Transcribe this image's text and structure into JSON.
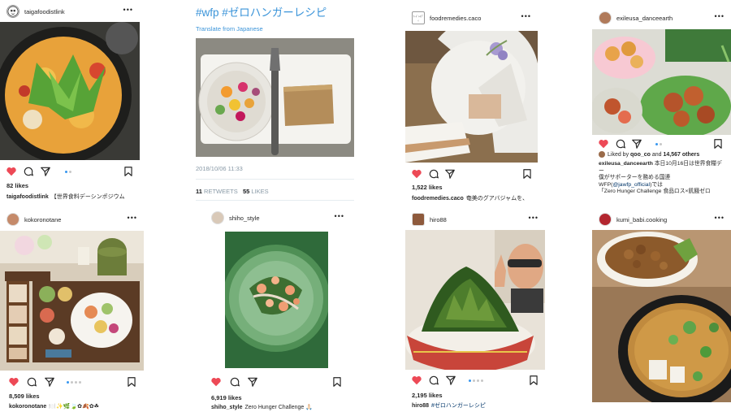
{
  "colors": {
    "heart": "#ed4956",
    "link": "#3b94d9",
    "dot_active": "#3897f0",
    "dot": "#c7c7c7"
  },
  "icons": [
    "heart-filled-icon",
    "comment-icon",
    "share-icon",
    "bookmark-icon",
    "more-icon"
  ],
  "posts": [
    {
      "username": "taigafoodistlink",
      "likes": "82 likes",
      "caption_user": "taigafoodistlink",
      "caption_text": "【世界食料デーシンポジウム"
    },
    {
      "username": "foodremedies.caco",
      "likes": "1,522 likes",
      "caption_user": "foodremedies.caco",
      "caption_text": "奄美のグアバジャムを、"
    },
    {
      "username": "exileusa_danceearth",
      "liked_by_pre": "Liked by ",
      "liked_by_user": "qoo_co",
      "liked_by_mid": " and ",
      "liked_by_count": "14,567 others",
      "caption_user": "exileusa_danceearth",
      "caption_line1": " 本日10月16日は世界食糧デー",
      "caption_line2": "僕がサポーターを務める国連",
      "caption_line3_pre": "WFP(",
      "caption_line3_mention": "@jawfp_official",
      "caption_line3_post": ")では",
      "caption_line4": "「Zero Hunger Challenge 食品ロス×飢餓ゼロ"
    },
    {
      "username": "kokoronotane",
      "likes": "8,509 likes",
      "caption_user": "kokoronotane",
      "caption_text": "🍽️✨🌿🍃✿🍂✿☘"
    },
    {
      "username": "shiho_style",
      "likes": "6,919 likes",
      "caption_user": "shiho_style",
      "caption_text": "Zero Hunger Challenge 🙏🏻"
    },
    {
      "username": "hiro88",
      "likes": "2,195 likes",
      "caption_user": "hiro88",
      "caption_tag": "#ゼロハンガーレシピ"
    },
    {
      "username": "kumi_babi.cooking"
    }
  ],
  "tweet": {
    "title": "#wfp #ゼロハンガーレシピ",
    "translate": "Translate from Japanese",
    "date": "2018/10/06 11:33",
    "retweets_count": "11",
    "retweets_label": "RETWEETS",
    "likes_count": "55",
    "likes_label": "LIKES"
  },
  "avatar_texts": {
    "foodremedies": "ﾌｰﾄﾞ ﾚﾒﾃﾞｨ"
  }
}
